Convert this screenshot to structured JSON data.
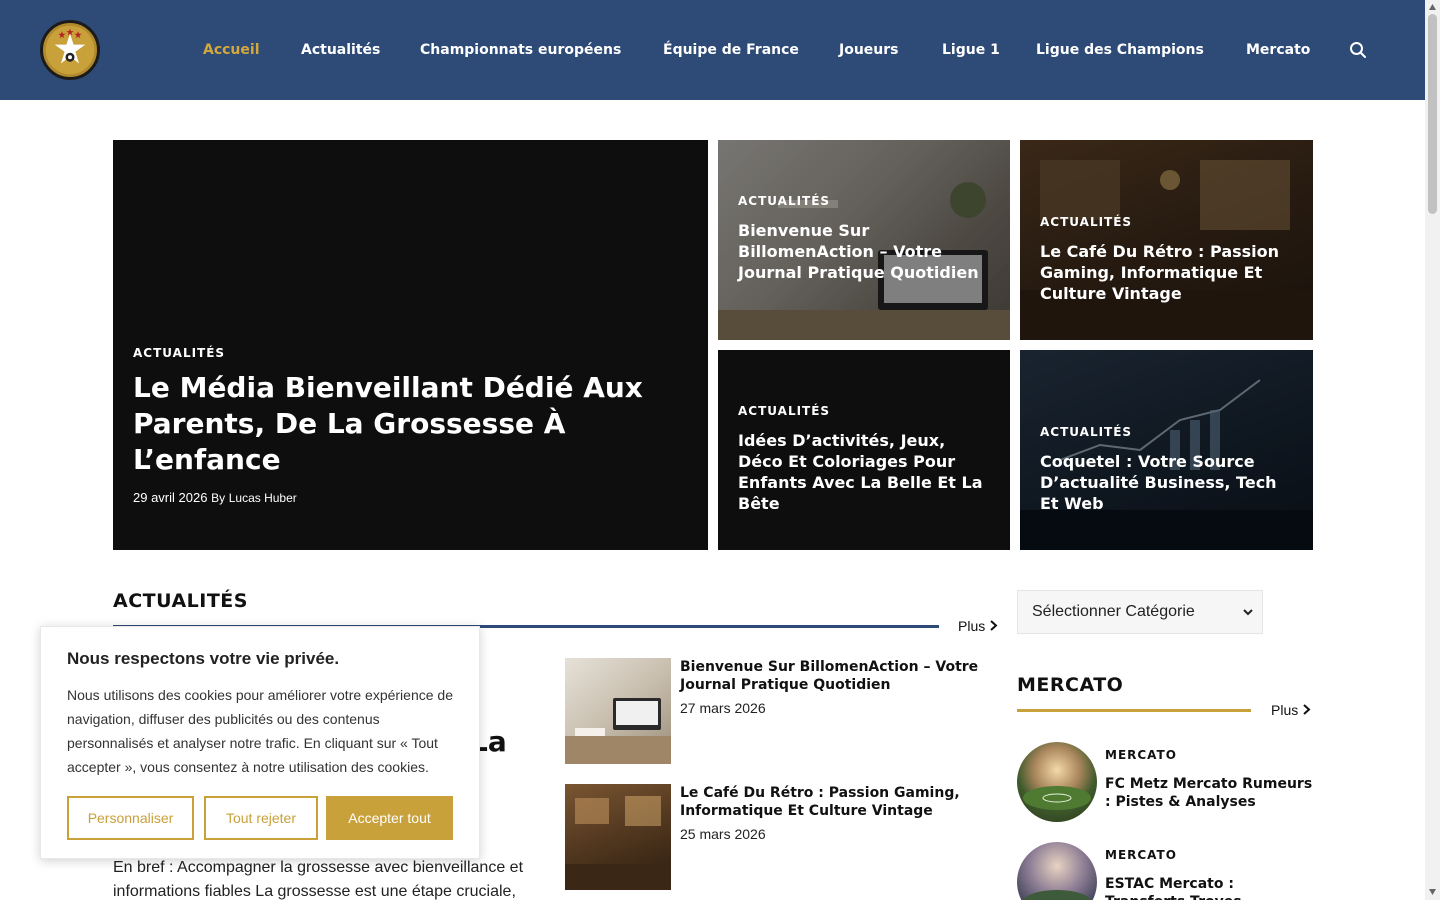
{
  "nav": {
    "items": [
      {
        "label": "Accueil",
        "active": true
      },
      {
        "label": "Actualités"
      },
      {
        "label": "Championnats européens"
      },
      {
        "label": "Équipe de France"
      },
      {
        "label": "Joueurs"
      },
      {
        "label": "Ligue 1"
      },
      {
        "label": "Ligue des Champions"
      },
      {
        "label": "Mercato"
      }
    ]
  },
  "hero": {
    "main": {
      "category": "ACTUALITÉS",
      "title": "Le Média Bienveillant Dédié Aux Parents, De La Grossesse À L’enfance",
      "date": "29 avril 2026",
      "by": "By",
      "author": "Lucas Huber"
    },
    "tiles": [
      {
        "category": "ACTUALITÉS",
        "title": "Bienvenue Sur BillomenAction – Votre Journal Pratique Quotidien"
      },
      {
        "category": "ACTUALITÉS",
        "title": "Le Café Du Rétro : Passion Gaming, Informatique Et Culture Vintage"
      },
      {
        "category": "ACTUALITÉS",
        "title": "Idées D’activités, Jeux, Déco Et Coloriages Pour Enfants Avec La Belle Et La Bête"
      },
      {
        "category": "ACTUALITÉS",
        "title": "Coquetel : Votre Source D’actualité Business, Tech Et Web"
      }
    ]
  },
  "section": {
    "title": "ACTUALITÉS",
    "more": "Plus",
    "partial_title": "La",
    "excerpt": "En bref : Accompagner la grossesse avec bienveillance et informations fiables La grossesse est une étape cruciale,",
    "posts": [
      {
        "title": "Bienvenue Sur BillomenAction – Votre Journal Pratique Quotidien",
        "date": "27 mars 2026"
      },
      {
        "title": "Le Café Du Rétro : Passion Gaming, Informatique Et Culture Vintage",
        "date": "25 mars 2026"
      }
    ]
  },
  "sidebar": {
    "select_label": "Sélectionner Catégorie",
    "title": "MERCATO",
    "more": "Plus",
    "posts": [
      {
        "category": "MERCATO",
        "title": "FC Metz Mercato Rumeurs : Pistes & Analyses"
      },
      {
        "category": "MERCATO",
        "title": "ESTAC Mercato : Transferts Troyes"
      }
    ]
  },
  "cookie": {
    "title": "Nous respectons votre vie privée.",
    "text": "Nous utilisons des cookies pour améliorer votre expérience de navigation, diffuser des publicités ou des contenus personnalisés et analyser notre trafic. En cliquant sur « Tout accepter », vous consentez à notre utilisation des cookies.",
    "customize": "Personnaliser",
    "reject": "Tout rejeter",
    "accept": "Accepter tout"
  },
  "colors": {
    "header": "#2e4b78",
    "accent": "#c9a13a",
    "active_nav": "#d4a83c"
  }
}
